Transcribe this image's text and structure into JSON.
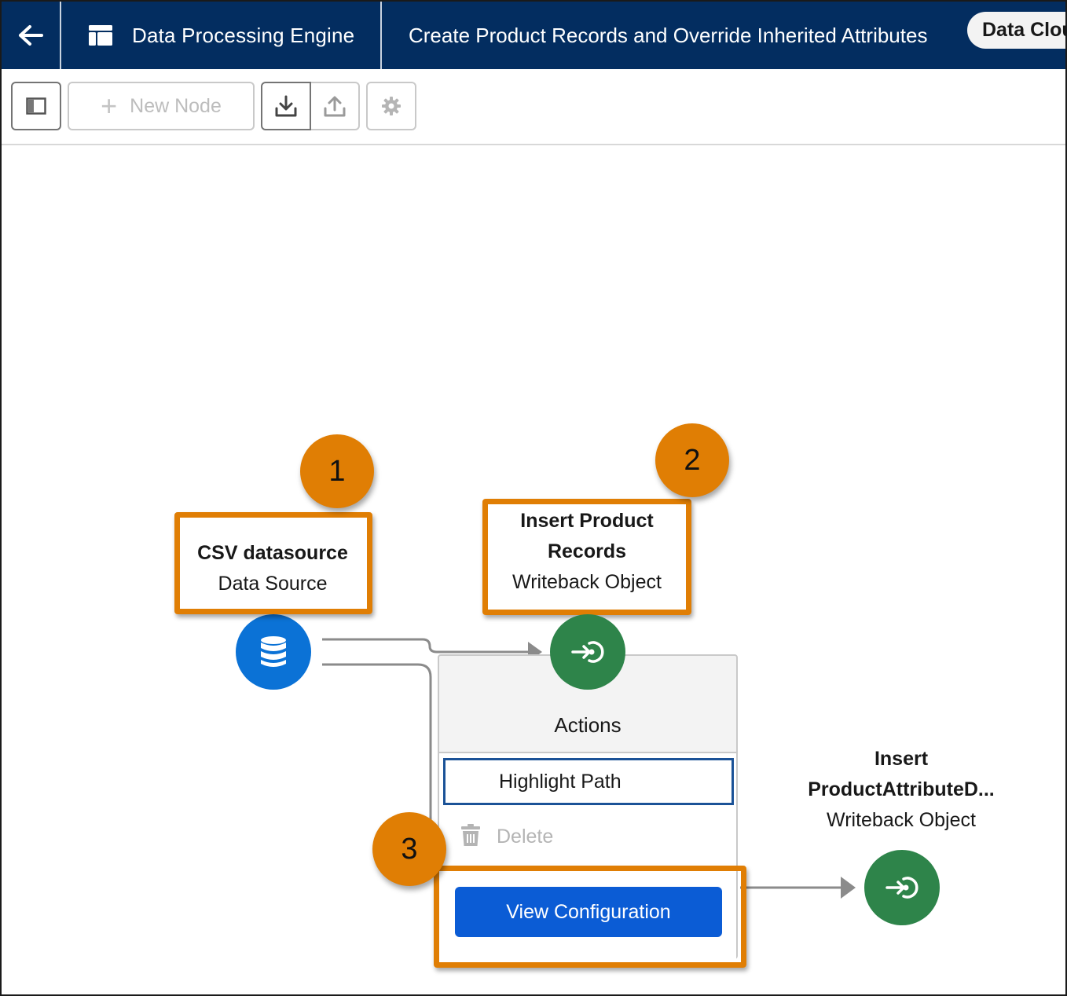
{
  "header": {
    "back_icon": "arrow-left-icon",
    "app_icon": "table-layout-icon",
    "app_title": "Data Processing Engine",
    "record_title": "Create Product Records and Override Inherited Attributes",
    "pill_label": "Data Clou"
  },
  "toolbar": {
    "panel_icon": "panel-toggle-icon",
    "new_node_label": "New Node",
    "new_node_icon": "plus-icon",
    "download_icon": "download-icon",
    "upload_icon": "upload-icon",
    "settings_icon": "gear-icon"
  },
  "canvas": {
    "nodes": [
      {
        "name": "CSV datasource",
        "type": "Data Source",
        "icon": "database-icon",
        "color": "#0b72d6"
      },
      {
        "name_line1": "Insert Product",
        "name_line2": "Records",
        "type": "Writeback Object",
        "icon": "writeback-icon",
        "color": "#2e844a"
      },
      {
        "name_line1": "Insert",
        "name_line2": "ProductAttributeD...",
        "type": "Writeback Object",
        "icon": "writeback-icon",
        "color": "#2e844a"
      }
    ],
    "actions_menu": {
      "title": "Actions",
      "items": [
        {
          "label": "Highlight Path",
          "state": "focused"
        },
        {
          "label": "Delete",
          "icon": "trash-icon",
          "state": "disabled"
        }
      ],
      "primary_button": "View Configuration"
    },
    "callouts": [
      "1",
      "2",
      "3"
    ]
  },
  "colors": {
    "header_bg": "#032d60",
    "callout": "#e07e04",
    "primary_button": "#0b5cd5",
    "data_source_node": "#0b72d6",
    "writeback_node": "#2e844a"
  }
}
